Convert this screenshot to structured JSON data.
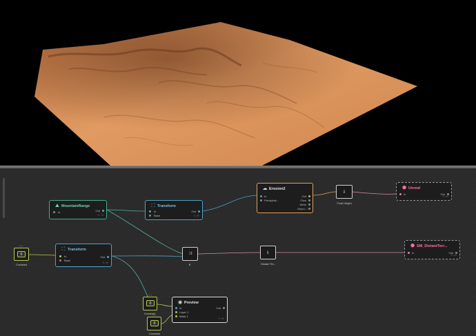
{
  "viewport": {
    "background": "#000000",
    "terrain_color": "#d98c55"
  },
  "graph": {
    "nodes": {
      "mountain_range": {
        "title": "MountainRange",
        "in": "In",
        "out": "Out",
        "meta": "0.76"
      },
      "transform_top": {
        "title": "Transform",
        "in": "In",
        "base": "Base",
        "out": "Out",
        "meta": "0.00"
      },
      "transform_mid": {
        "title": "Transform",
        "in": "In",
        "base": "Base",
        "out": "Out",
        "meta": "0.00"
      },
      "erosion2": {
        "title": "Erosion2",
        "in": "In",
        "precip": "Precipitati...",
        "out": "Out",
        "flow": "Flow",
        "wear": "Wear",
        "depo": "Depo...",
        "meta": "0.75"
      },
      "unreal": {
        "title": "Unreal",
        "in": "In",
        "out": "Out",
        "meta": "0.00"
      },
      "sm_distant": {
        "title": "SM_DistantTerr...",
        "in": "In",
        "out": "Out",
        "meta": "0.00"
      },
      "preview": {
        "title": "Preview",
        "in": "In",
        "layer1": "Layer 1",
        "mask1": "Mask 1",
        "out": "Out",
        "meta": "0.00"
      }
    },
    "small": {
      "final_height": {
        "glyph": "⇩",
        "caption": "Final Height"
      },
      "distant": {
        "glyph": "⇩",
        "caption": "Distant Ter..."
      },
      "combine": {
        "glyph": "⤨",
        "caption": "B"
      }
    },
    "constants": [
      {
        "label": "Constant",
        "value": "0",
        "tag": "0.1"
      },
      {
        "label": "Constant",
        "value": "0",
        "tag": "0.1"
      },
      {
        "label": "Constant",
        "value": "0",
        "tag": "0.1"
      }
    ]
  }
}
